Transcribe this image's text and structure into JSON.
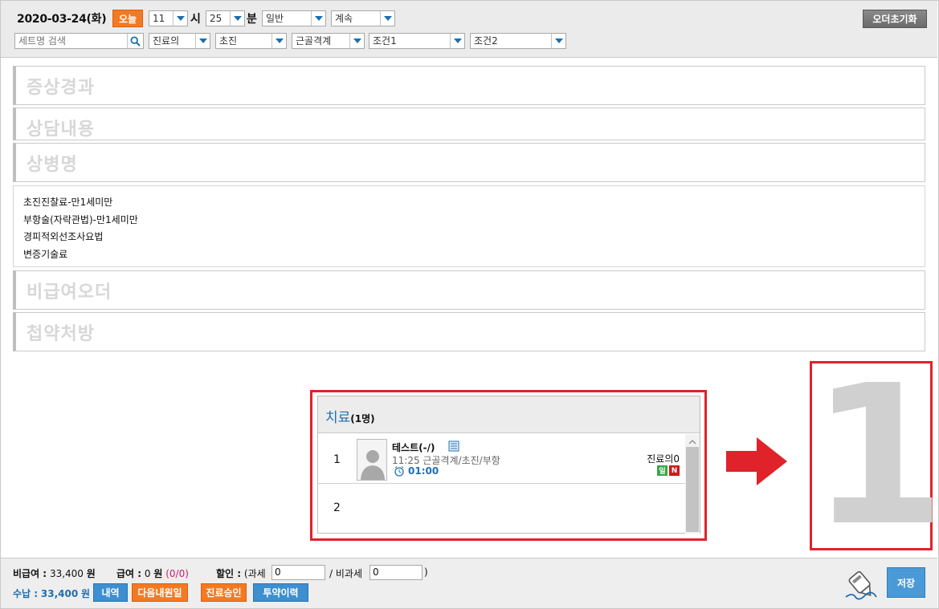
{
  "toolbar": {
    "date": "2020-03-24(화)",
    "today_label": "오늘",
    "hour_value": "11",
    "hour_unit": "시",
    "minute_value": "25",
    "minute_unit": "분",
    "type_value": "일반",
    "continue_value": "계속",
    "reset_label": "오더초기화",
    "search_placeholder": "세트명 검색",
    "doctor_value": "진료의",
    "visit_value": "초진",
    "dept_value": "근골격계",
    "cond1_value": "조건1",
    "cond2_value": "조건2"
  },
  "sections": {
    "symptom": "증상경과",
    "consult": "상담내용",
    "diagnosis": "상병명",
    "nonpay": "비급여오더",
    "prescription": "첩약처방"
  },
  "orders": [
    "초진진찰료-만1세미만",
    "부항술(자락관법)-만1세미만",
    "경피적외선조사요법",
    "변증기술료"
  ],
  "queue": {
    "title": "치료",
    "count": "(1명)",
    "rows": [
      {
        "num": "1",
        "name": "테스트(-/)",
        "detail": "11:25  근골격계/초진/부항",
        "elapsed": "01:00",
        "doctor": "진료의0",
        "badge1": "일",
        "badge2": "N"
      },
      {
        "num": "2"
      }
    ]
  },
  "waiting_count": "1",
  "footer": {
    "nonpay_label": "비급여 :",
    "nonpay_value": "33,400",
    "won": "원",
    "pay_label": "급여 :",
    "pay_value": "0",
    "pay_ratio": "(0/0)",
    "discount_label": "할인 :",
    "tax_label": "(과세",
    "tax_value": "0",
    "nontax_label": "/ 비과세",
    "nontax_value": "0",
    "close_paren": ")",
    "received_label": "수납 :",
    "received_value": "33,400",
    "history_btn": "내역",
    "next_visit_btn": "다음내원일",
    "approve_btn": "진료승인",
    "med_history_btn": "투약이력",
    "save_btn": "저장"
  },
  "colors": {
    "accent_orange": "#f37a22",
    "accent_blue": "#1e6fb2",
    "highlight_red": "#e0222a"
  }
}
